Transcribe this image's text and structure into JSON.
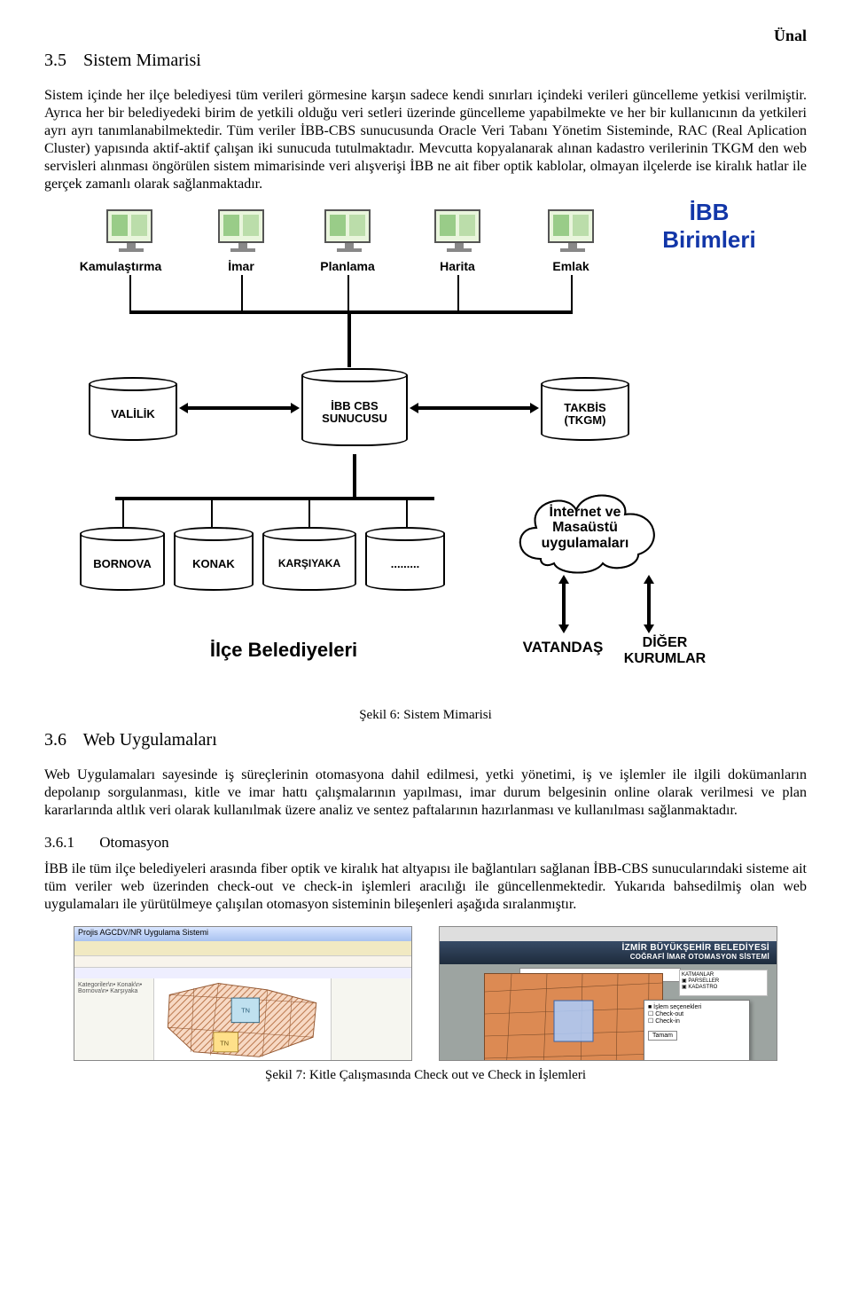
{
  "page_header_name": "Ünal",
  "sec35": {
    "num": "3.5",
    "title": "Sistem Mimarisi"
  },
  "para35": "Sistem içinde her ilçe belediyesi tüm verileri görmesine karşın sadece kendi sınırları içindeki verileri güncelleme yetkisi verilmiştir. Ayrıca her bir belediyedeki birim de yetkili olduğu veri setleri üzerinde güncelleme yapabilmekte ve her bir kullanıcının da yetkileri ayrı ayrı tanımlanabilmektedir. Tüm veriler İBB-CBS sunucusunda Oracle Veri Tabanı Yönetim Sisteminde, RAC (Real Aplication Cluster) yapısında aktif-aktif çalışan iki sunucuda tutulmaktadır. Mevcutta kopyalanarak alınan kadastro verilerinin TKGM den web servisleri alınması öngörülen sistem mimarisinde veri alışverişi İBB ne ait fiber optik kablolar, olmayan ilçelerde ise kiralık hatlar ile gerçek zamanlı olarak sağlanmaktadır.",
  "diagram": {
    "ibb_birimleri_title": "İBB\nBirimleri",
    "monitors": [
      "Kamulaştırma",
      "İmar",
      "Planlama",
      "Harita",
      "Emlak"
    ],
    "db_valilik": "VALİLİK",
    "db_center_line1": "İBB CBS",
    "db_center_line2": "SUNUCUSU",
    "db_takbis_line1": "TAKBİS",
    "db_takbis_line2": "(TKGM)",
    "db_bornova": "BORNOVA",
    "db_konak": "KONAK",
    "db_karsiyaka": "KARŞIYAKA",
    "db_more": ".........",
    "cloud_line1": "İnternet ve",
    "cloud_line2": "Masaüstü",
    "cloud_line3": "uygulamaları",
    "ilce_label": "İlçe Belediyeleri",
    "vatandas": "VATANDAŞ",
    "diger_line1": "DİĞER",
    "diger_line2": "KURUMLAR"
  },
  "fig6_caption": "Şekil 6: Sistem Mimarisi",
  "sec36": {
    "num": "3.6",
    "title": "Web Uygulamaları"
  },
  "para36": "Web Uygulamaları sayesinde iş süreçlerinin otomasyona dahil edilmesi, yetki yönetimi, iş ve işlemler ile ilgili dokümanların depolanıp sorgulanması, kitle ve imar hattı çalışmalarının yapılması, imar durum belgesinin online olarak verilmesi ve plan kararlarında altlık veri olarak kullanılmak üzere analiz ve sentez paftalarının hazırlanması ve kullanılması sağlanmaktadır.",
  "sec361": {
    "num": "3.6.1",
    "title": "Otomasyon"
  },
  "para361": "İBB ile tüm ilçe belediyeleri arasında fiber optik ve kiralık hat altyapısı ile bağlantıları sağlanan İBB-CBS sunucularındaki sisteme ait tüm veriler web üzerinden check-out ve check-in işlemleri aracılığı ile güncellenmektedir. Yukarıda bahsedilmiş olan web uygulamaları ile yürütülmeye çalışılan otomasyon sisteminin bileşenleri aşağıda sıralanmıştır.",
  "shot1": {
    "titlebar": "Projis AGCDV/NR Uygulama Sistemi",
    "sidebar": "Kategoriler\\n• Konak\\n• Bornova\\n• Karşıyaka"
  },
  "shot2": {
    "banner_line1": "İZMİR BÜYÜKŞEHİR BELEDİYESİ",
    "banner_line2": "COĞRAFİ İMAR OTOMASYON SİSTEMİ"
  },
  "fig7_caption": "Şekil 7: Kitle Çalışmasında Check out ve Check in İşlemleri"
}
